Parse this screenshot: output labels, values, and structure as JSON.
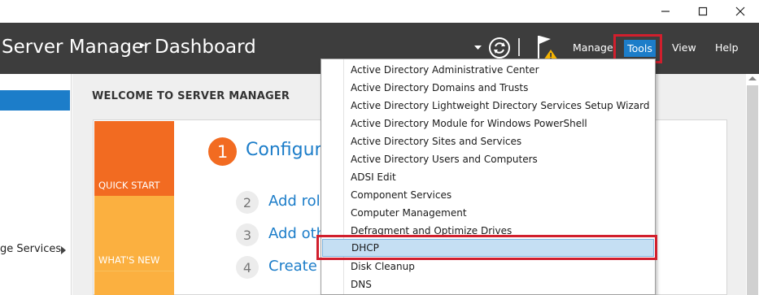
{
  "window": {
    "controls": {
      "minimize_icon": "—",
      "maximize_icon": "☐",
      "close_icon": "✕"
    }
  },
  "header": {
    "breadcrumb_app": "Server Manager",
    "breadcrumb_sep": "▸",
    "breadcrumb_page": "Dashboard",
    "menu": {
      "manage": "Manage",
      "tools": "Tools",
      "view": "View",
      "help": "Help"
    },
    "icons": [
      "dropdown-arrow-icon",
      "refresh-icon",
      "notifications-flag-icon"
    ]
  },
  "sidebar": {
    "item_label": "ge Services"
  },
  "main": {
    "welcome_title": "WELCOME TO SERVER MANAGER",
    "tiles": {
      "quick_start": "QUICK START",
      "whats_new": "WHAT'S NEW"
    },
    "steps": [
      {
        "number": "1",
        "text": "Configure"
      },
      {
        "number": "2",
        "text": "Add role"
      },
      {
        "number": "3",
        "text": "Add oth"
      },
      {
        "number": "4",
        "text": "Create a"
      }
    ]
  },
  "tools_menu": {
    "items": [
      "Active Directory Administrative Center",
      "Active Directory Domains and Trusts",
      "Active Directory Lightweight Directory Services Setup Wizard",
      "Active Directory Module for Windows PowerShell",
      "Active Directory Sites and Services",
      "Active Directory Users and Computers",
      "ADSI Edit",
      "Component Services",
      "Computer Management",
      "Defragment and Optimize Drives",
      "DHCP",
      "Disk Cleanup",
      "DNS"
    ],
    "selected": "DHCP"
  },
  "colors": {
    "accent": "#1c7dc9",
    "highlight": "#d11f2d",
    "header_bg": "#3d3d3d",
    "quick_start": "#f26b21",
    "whats_new": "#fbb040"
  }
}
